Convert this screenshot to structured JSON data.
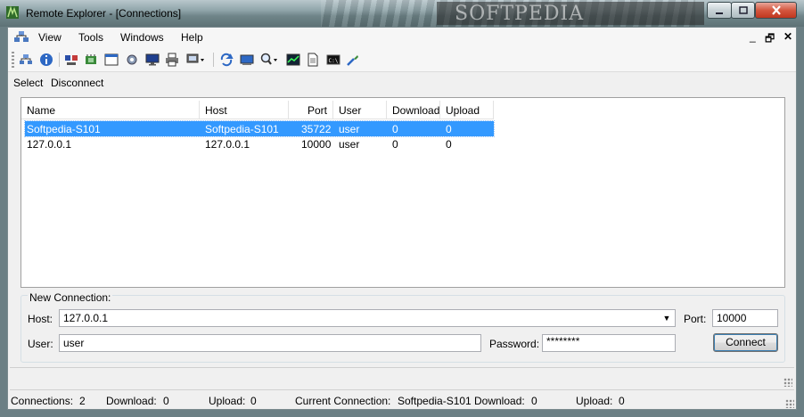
{
  "window": {
    "title": "Remote Explorer - [Connections]",
    "watermark": "SOFTPEDIA",
    "controls": {
      "minimize": "minimize",
      "maximize": "maximize",
      "close": "close"
    }
  },
  "menu": {
    "items": [
      "View",
      "Tools",
      "Windows",
      "Help"
    ],
    "mdi": {
      "minimize": "_",
      "restore": "🗗",
      "close": "✕"
    }
  },
  "toolbar": {
    "icons": [
      "network-icon",
      "info-icon",
      "computer-tree-icon",
      "hardware-icon",
      "window-icon",
      "settings-gear-icon",
      "monitor-icon",
      "printer-icon",
      "display-dropdown-icon",
      "refresh-icon",
      "screen-icon",
      "search-dropdown-icon",
      "graph-icon",
      "document-icon",
      "console-icon",
      "tools-icon"
    ]
  },
  "subbar": {
    "select": "Select",
    "disconnect": "Disconnect"
  },
  "connections_table": {
    "columns": [
      "Name",
      "Host",
      "Port",
      "User",
      "Download",
      "Upload"
    ],
    "rows": [
      {
        "name": "Softpedia-S101",
        "host": "Softpedia-S101",
        "port": "35722",
        "user": "user",
        "download": "0",
        "upload": "0",
        "selected": true
      },
      {
        "name": "127.0.0.1",
        "host": "127.0.0.1",
        "port": "10000",
        "user": "user",
        "download": "0",
        "upload": "0",
        "selected": false
      }
    ]
  },
  "new_connection": {
    "title": "New Connection:",
    "host_label": "Host:",
    "host_value": "127.0.0.1",
    "port_label": "Port:",
    "port_value": "10000",
    "user_label": "User:",
    "user_value": "user",
    "password_label": "Password:",
    "password_value": "********",
    "connect_label": "Connect"
  },
  "status": {
    "connections_label": "Connections:",
    "connections_value": "2",
    "download_label": "Download:",
    "download_value": "0",
    "upload_label": "Upload:",
    "upload_value": "0",
    "current_label": "Current Connection:",
    "current_value": "Softpedia-S101",
    "current_download_label": "Download:",
    "current_download_value": "0",
    "current_upload_label": "Upload:",
    "current_upload_value": "0"
  }
}
